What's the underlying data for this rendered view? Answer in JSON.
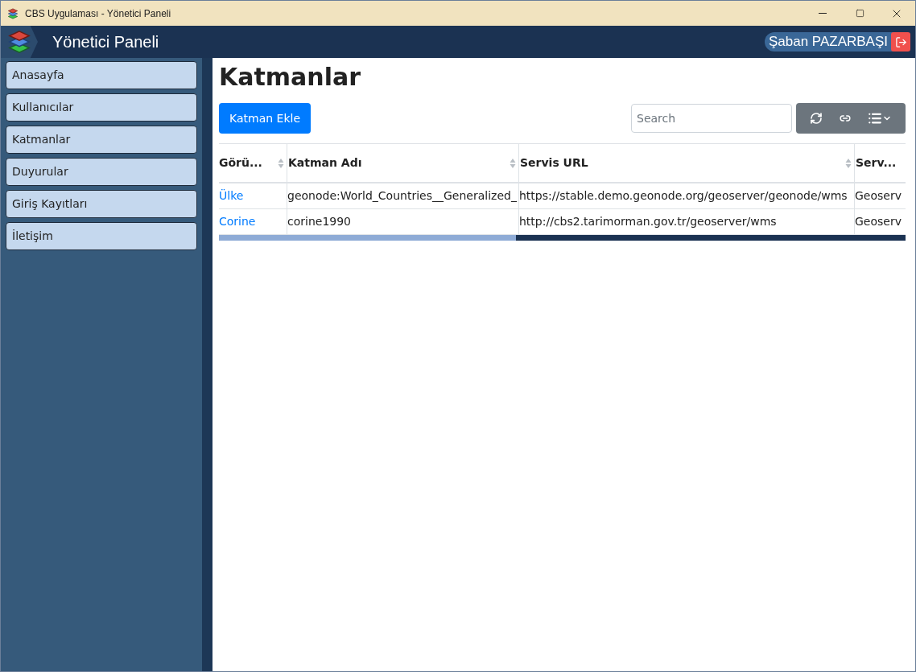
{
  "window": {
    "title": "CBS Uygulaması - Yönetici Paneli"
  },
  "header": {
    "title": "Yönetici Paneli",
    "user": "Şaban PAZARBAŞI"
  },
  "sidebar": {
    "items": [
      {
        "label": "Anasayfa"
      },
      {
        "label": "Kullanıcılar"
      },
      {
        "label": "Katmanlar"
      },
      {
        "label": "Duyurular"
      },
      {
        "label": "Giriş Kayıtları"
      },
      {
        "label": "İletişim"
      }
    ]
  },
  "page": {
    "title": "Katmanlar",
    "add_button": "Katman Ekle",
    "search": {
      "placeholder": "Search"
    }
  },
  "table": {
    "columns": [
      "Görü...",
      "Katman Adı",
      "Servis URL",
      "Serv..."
    ],
    "rows": [
      [
        "Ülke",
        "geonode:World_Countries__Generalized_",
        "https://stable.demo.geonode.org/geoserver/geonode/wms",
        "Geoserv"
      ],
      [
        "Corine",
        "corine1990",
        "http://cbs2.tarimorman.gov.tr/geoserver/wms",
        "Geoserv"
      ]
    ]
  }
}
